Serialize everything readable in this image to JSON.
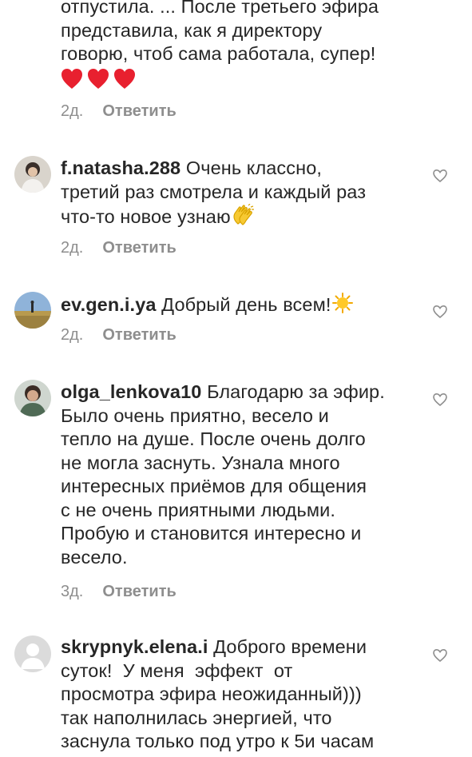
{
  "comments": [
    {
      "lines": [
        "отпустила. ... После третьего эфира",
        "представила, как я директору",
        "говорю, чтоб сама работала, супер!"
      ],
      "emoji": "heart-emoji",
      "time": "2д.",
      "reply": "Ответить"
    },
    {
      "username": "f.natasha.288",
      "first": "Очень классно,",
      "lines": [
        "третий раз смотрела и каждый раз",
        "что-то новое узнаю"
      ],
      "emoji": "clapping-hands-emoji",
      "time": "2д.",
      "reply": "Ответить"
    },
    {
      "username": "ev.gen.i.ya",
      "first": "Добрый день всем!",
      "emoji": "sun-emoji",
      "time": "2д.",
      "reply": "Ответить"
    },
    {
      "username": "olga_lenkova10",
      "first": "Благодарю за эфир.",
      "lines": [
        "Было очень приятно, весело и",
        "тепло на душе. После очень долго",
        "не могла заснуть. Узнала много",
        "интересных приёмов для общения",
        "с не очень приятными людьми.",
        "Пробую и становится интересно и",
        "весело."
      ],
      "time": "3д.",
      "reply": "Ответить"
    },
    {
      "username": "skrypnyk.elena.i",
      "first": "Доброго времени",
      "lines": [
        "суток!  У меня  эффект  от",
        "просмотра эфира неожиданный)))",
        "так наполнилась энергией, что",
        "заснула только под утро к 5и часам"
      ]
    }
  ],
  "colors": {
    "text": "#262626",
    "meta": "#8e8e8e",
    "heart_emoji": "#e8202f",
    "like_outline": "#8e8e8e"
  }
}
